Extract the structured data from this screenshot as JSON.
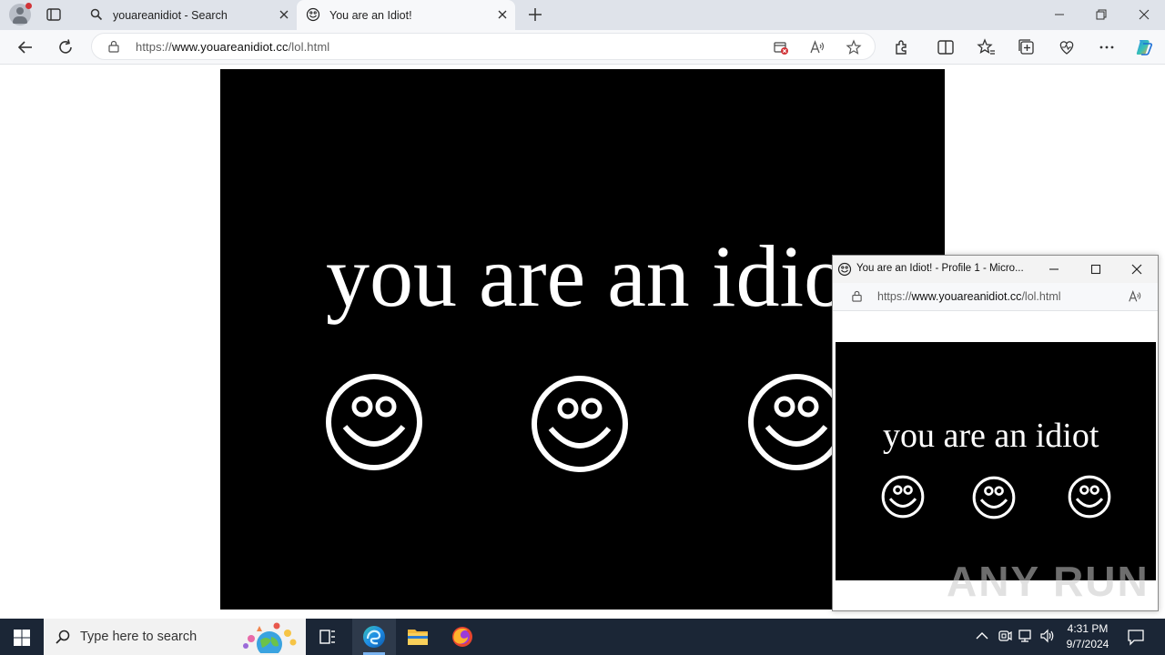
{
  "browser": {
    "tabs": [
      {
        "label": "youareanidiot - Search",
        "icon": "search-icon",
        "active": false
      },
      {
        "label": "You are an Idiot!",
        "icon": "smiley-favicon",
        "active": true
      }
    ],
    "address": {
      "prefix": "https://",
      "host": "www.youareanidiot.cc",
      "path": "/lol.html"
    },
    "accent": "#0078d4"
  },
  "page": {
    "headline": "you are an idiot",
    "background": "#000000",
    "foreground": "#ffffff"
  },
  "popup": {
    "title": "You are an Idiot! - Profile 1 - Micro...",
    "address": {
      "prefix": "https://",
      "host": "www.youareanidiot.cc",
      "path": "/lol.html"
    },
    "headline": "you are an idiot"
  },
  "watermark": "ANY RUN",
  "taskbar": {
    "search_placeholder": "Type here to search",
    "time": "4:31 PM",
    "date": "9/7/2024",
    "background": "#1b2636"
  }
}
